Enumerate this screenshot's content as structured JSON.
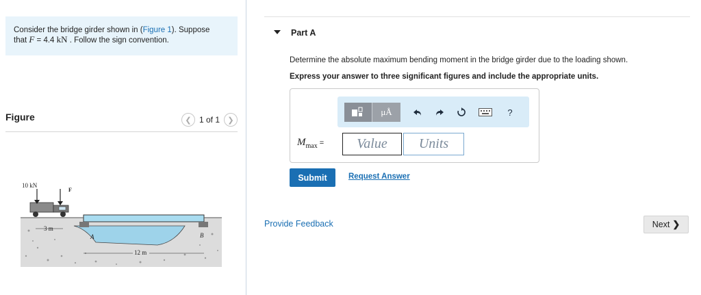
{
  "problem": {
    "text_1": "Consider the bridge girder shown in (",
    "figure_link": "Figure 1",
    "text_2": "). Suppose",
    "text_3": "that ",
    "variable": "F",
    "text_4": " = 4.4 ",
    "unit": "kN",
    "text_5": " . Follow the sign convention."
  },
  "figure": {
    "title": "Figure",
    "pager": "1 of 1",
    "labels": {
      "load": "10 kN",
      "force": "F",
      "spacing": "3 m",
      "point_a": "A",
      "point_b": "B",
      "span": "12 m"
    }
  },
  "part": {
    "title": "Part A",
    "question": "Determine the absolute maximum bending moment in the bridge girder due to the loading shown.",
    "instruction": "Express your answer to three significant figures and include the appropriate units."
  },
  "answer": {
    "label_main": "M",
    "label_sub": "max",
    "label_eq": "=",
    "value_placeholder": "Value",
    "units_placeholder": "Units",
    "mu_label": "μÅ",
    "help_label": "?"
  },
  "actions": {
    "submit": "Submit",
    "request": "Request Answer",
    "feedback": "Provide Feedback",
    "next": "Next"
  },
  "colors": {
    "accent": "#1a6fb3",
    "problem_bg": "#e8f4fb",
    "toolbar_bg": "#d9ecf8"
  }
}
